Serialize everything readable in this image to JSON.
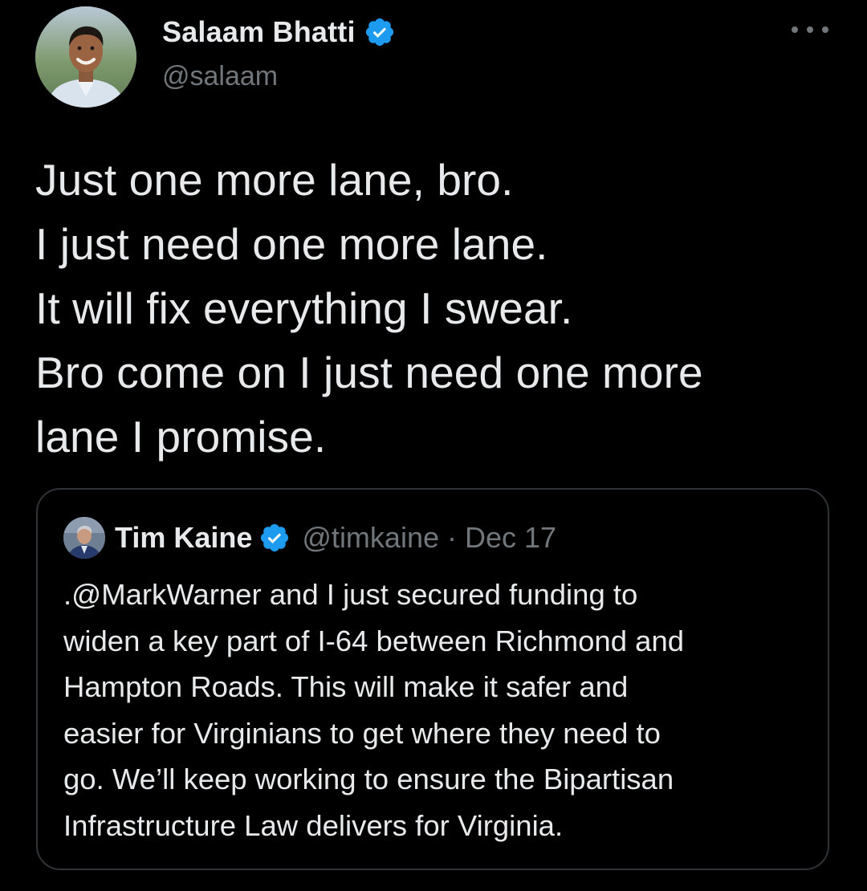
{
  "author": {
    "display_name": "Salaam Bhatti",
    "handle": "@salaam",
    "verified": true,
    "avatar_icon": "profile-photo"
  },
  "tweet": {
    "text_lines": [
      "Just one more lane, bro.",
      "I just need one more lane.",
      "It will fix everything I swear.",
      "Bro come on I just need one more",
      "lane I promise."
    ]
  },
  "quoted_tweet": {
    "display_name": "Tim Kaine",
    "handle": "@timkaine",
    "separator": "·",
    "date": "Dec 17",
    "verified": true,
    "avatar_icon": "profile-photo",
    "text_lines": [
      ".@MarkWarner and I just secured funding to",
      "widen a key part of I-64 between Richmond and",
      "Hampton Roads. This will make it safer and",
      "easier for Virginians to get where they need to",
      "go. We’ll keep working to ensure the Bipartisan",
      "Infrastructure Law delivers for Virginia."
    ]
  },
  "icons": {
    "verified_badge": "verified-icon",
    "more": "more-options-icon"
  },
  "colors": {
    "background": "#000000",
    "primary_text": "#e7e9ea",
    "secondary_text": "#71767b",
    "verified_blue": "#1d9bf0",
    "card_border": "#2f3336"
  }
}
